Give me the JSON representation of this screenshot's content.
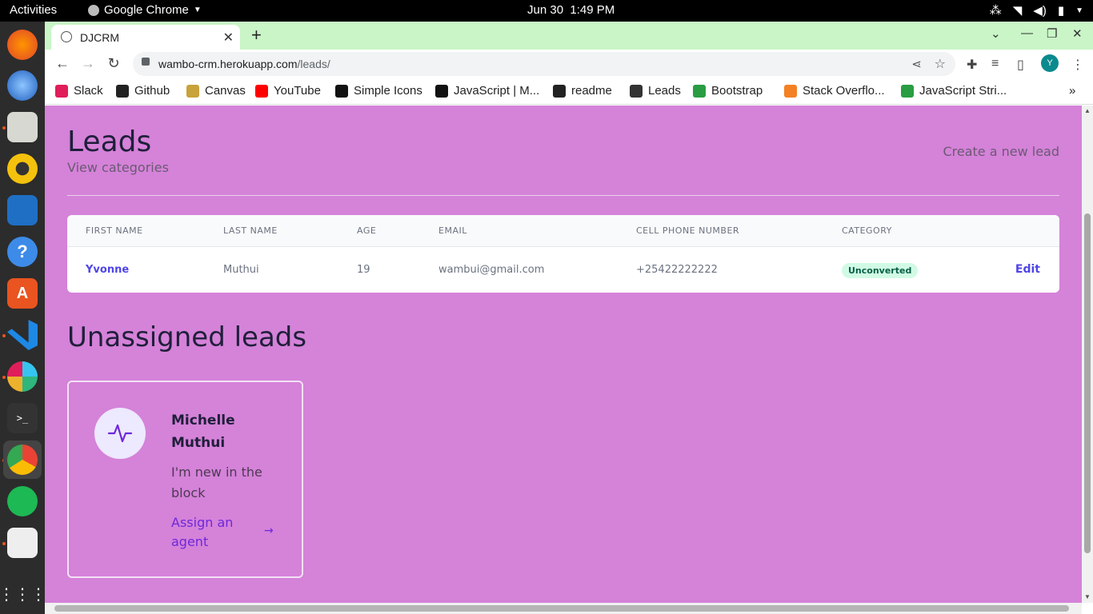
{
  "topbar": {
    "activities": "Activities",
    "app_name": "Google Chrome",
    "date": "Jun 30",
    "time": "1:49 PM"
  },
  "browser": {
    "tab_title": "DJCRM",
    "url_host": "wambo-crm.herokuapp.com",
    "url_path": "/leads/",
    "avatar_letter": "Y",
    "bookmarks": [
      {
        "label": "Slack",
        "color": "#e01e5a"
      },
      {
        "label": "Github",
        "color": "#222222"
      },
      {
        "label": "Canvas",
        "color": "#c8a23a"
      },
      {
        "label": "YouTube",
        "color": "#ff0000"
      },
      {
        "label": "Simple Icons",
        "color": "#111111"
      },
      {
        "label": "JavaScript | M...",
        "color": "#111111"
      },
      {
        "label": "readme",
        "color": "#222222"
      },
      {
        "label": "Leads",
        "color": "#333333"
      },
      {
        "label": "Bootstrap",
        "color": "#2a9d43"
      },
      {
        "label": "Stack Overflo...",
        "color": "#f48024"
      },
      {
        "label": "JavaScript Stri...",
        "color": "#2a9d43"
      }
    ]
  },
  "page": {
    "title": "Leads",
    "view_categories": "View categories",
    "create_new": "Create a new lead",
    "table": {
      "headers": [
        "FIRST NAME",
        "LAST NAME",
        "AGE",
        "EMAIL",
        "CELL PHONE NUMBER",
        "CATEGORY"
      ],
      "rows": [
        {
          "first_name": "Yvonne",
          "last_name": "Muthui",
          "age": "19",
          "email": "wambui@gmail.com",
          "phone": "+25422222222",
          "category": "Unconverted",
          "action": "Edit"
        }
      ]
    },
    "unassigned_title": "Unassigned leads",
    "unassigned_card": {
      "name": "Michelle Muthui",
      "description": "I'm new in the block",
      "assign_label": "Assign an agent"
    }
  },
  "colors": {
    "page_bg": "#d582d9",
    "accent": "#4f46e5",
    "tab_strip": "#c9f5c7"
  }
}
